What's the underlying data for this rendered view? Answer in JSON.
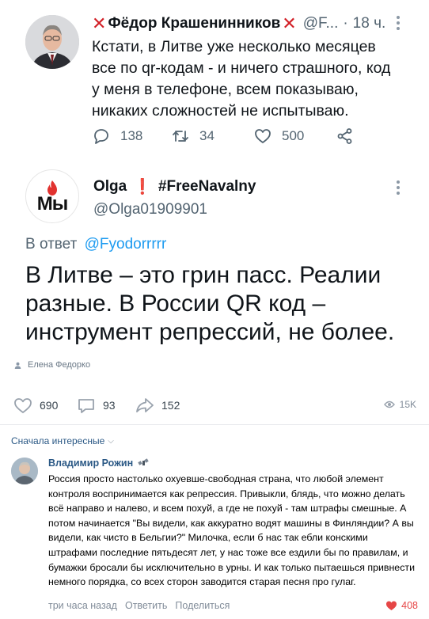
{
  "tweet1": {
    "author_name": "Фёдор Крашенинников",
    "handle": "@F...",
    "separator": "·",
    "time": "18 ч.",
    "text_lines": [
      "Кстати, в Литве уже несколько месяцев",
      "все по qr-кодам - и ничего страшного, код",
      "у меня в телефоне, всем показываю,",
      "никаких сложностей не испытываю."
    ],
    "replies": "138",
    "retweets": "34",
    "likes": "500",
    "icons": [
      "reply-icon",
      "retweet-icon",
      "like-icon",
      "share-icon"
    ]
  },
  "tweet2": {
    "author_name": "Olga",
    "author_tag": "#FreeNavalny",
    "author_flag": "❗",
    "avatar_logo": "Мы",
    "handle": "@Olga01909901",
    "reply_prefix": "В ответ",
    "reply_to": "@Fyodorrrrr",
    "text_lines": [
      "В Литве – это грин пасс. Реалии",
      "разные. В России QR код –",
      "инструмент репрессий, не более."
    ]
  },
  "post": {
    "image_caption": "Елена Федорко",
    "likes": "690",
    "comments": "93",
    "shares": "152",
    "views": "15K"
  },
  "comments_section": {
    "sort_label": "Сначала интересные",
    "comment": {
      "author": "Владимир Рожин",
      "text": "Россия просто настолько охуевше-свободная страна, что любой элемент контроля воспринимается как репрессия. Привыкли, блядь, что можно делать всё направо и налево, и всем похуй, а где не похуй - там штрафы смешные. А потом начинается \"Вы видели, как аккуратно водят машины в Финляндии? А вы видели, как чисто в Бельгии?\" Милочка, если б нас так ебли конскими штрафами последние пятьдесят лет, у нас тоже все ездили бы по правилам, и бумажки бросали бы исключительно в урны. И как только пытаешься привнести немного порядка, со всех сторон заводится старая песня про гулаг.",
      "time": "три часа назад",
      "reply_label": "Ответить",
      "share_label": "Поделиться",
      "likes": "408"
    }
  },
  "colors": {
    "twitter_text": "#0f1419",
    "twitter_muted": "#536471",
    "twitter_link": "#1d9bf0",
    "vk_link": "#2a5885",
    "vk_muted": "#818c99",
    "like_red": "#e64646",
    "red_x": "#d21f26"
  }
}
